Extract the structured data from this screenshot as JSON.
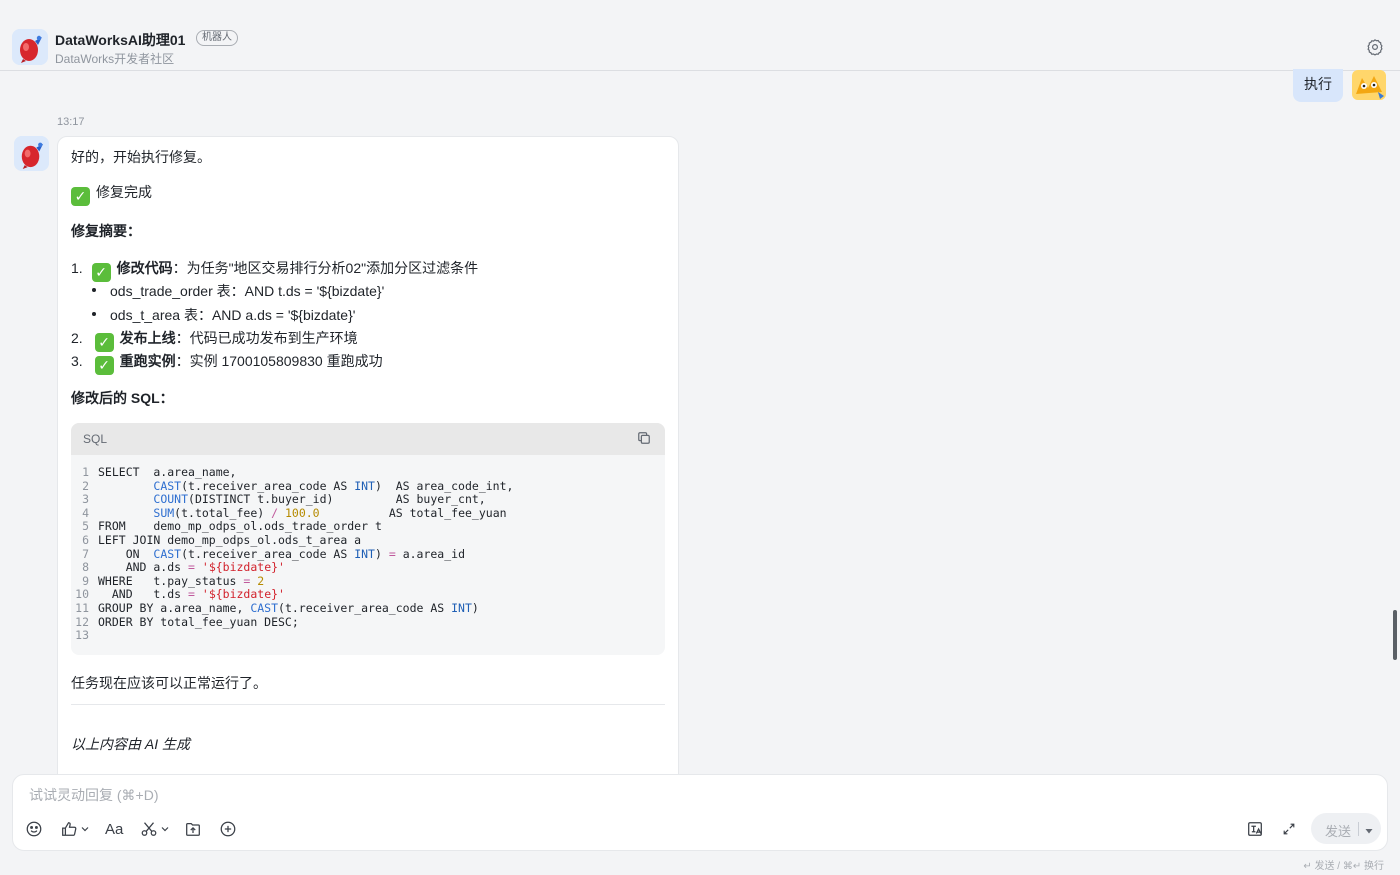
{
  "header": {
    "title": "DataWorksAI助理01",
    "bot_tag": "机器人",
    "subtitle": "DataWorks开发者社区",
    "settings_icon": "gear-icon"
  },
  "user_message": {
    "text": "执行"
  },
  "timestamp": "13:17",
  "bot_message": {
    "intro": "好的，开始执行修复。",
    "status": "修复完成",
    "summary_heading": "修复摘要：",
    "items": [
      {
        "num": "1.",
        "title": "修改代码",
        "colon": "：",
        "text": "为任务\"地区交易排行分析02\"添加分区过滤条件",
        "sub": [
          {
            "table": "ods_trade_order",
            "suffix": " 表：",
            "cond": "AND t.ds = '${bizdate}'"
          },
          {
            "table": "ods_t_area",
            "suffix": " 表：",
            "cond": "AND a.ds = '${bizdate}'"
          }
        ]
      },
      {
        "num": "2.",
        "title": "发布上线",
        "colon": "：",
        "text": "代码已成功发布到生产环境"
      },
      {
        "num": "3.",
        "title": "重跑实例",
        "colon": "：",
        "text": "实例 1700105809830 重跑成功"
      }
    ],
    "sql_heading": "修改后的 SQL：",
    "code": {
      "language": "SQL",
      "lines": [
        "SELECT  a.area_name,",
        "        CAST(t.receiver_area_code AS INT)  AS area_code_int,",
        "        COUNT(DISTINCT t.buyer_id)         AS buyer_cnt,",
        "        SUM(t.total_fee) / 100.0          AS total_fee_yuan",
        "FROM    demo_mp_odps_ol.ods_trade_order t",
        "LEFT JOIN demo_mp_odps_ol.ods_t_area a",
        "    ON  CAST(t.receiver_area_code AS INT) = a.area_id",
        "    AND a.ds = '${bizdate}'",
        "WHERE   t.pay_status = 2",
        "  AND   t.ds = '${bizdate}'",
        "GROUP BY a.area_name, CAST(t.receiver_area_code AS INT)",
        "ORDER BY total_fee_yuan DESC;",
        ""
      ]
    },
    "closing": "任务现在应该可以正常运行了。",
    "ai_note": "以上内容由 AI 生成"
  },
  "composer": {
    "placeholder": "试试灵动回复 (⌘+D)",
    "format_label": "Aa",
    "send_label": "发送",
    "shortcut_hint": "↵ 发送 / ⌘↵ 换行"
  },
  "colors": {
    "accent": "#d8e6fb",
    "check": "#5bbd3b",
    "string": "#d2232d",
    "keyword": "#2f6fd0"
  }
}
